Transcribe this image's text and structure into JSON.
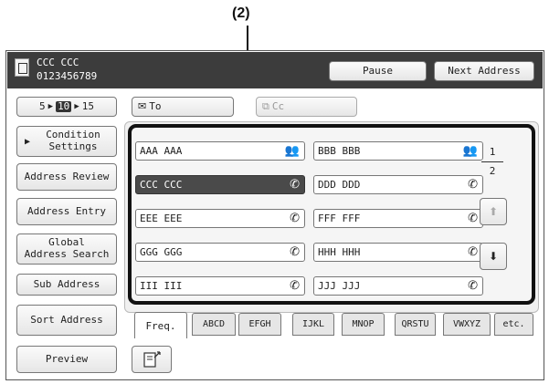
{
  "callout": "(2)",
  "header": {
    "name": "CCC CCC",
    "number": "0123456789",
    "pause_label": "Pause",
    "next_address_label": "Next Address"
  },
  "display_count": {
    "options": [
      "5",
      "10",
      "15"
    ],
    "selected": "10"
  },
  "to_label": "To",
  "cc_label": "Cc",
  "sidebar": {
    "condition_settings": "Condition\nSettings",
    "address_review": "Address Review",
    "address_entry": "Address Entry",
    "global_search": "Global\nAddress Search",
    "sub_address": "Sub Address",
    "sort_address": "Sort Address",
    "preview": "Preview"
  },
  "addresses": [
    {
      "name": "AAA AAA",
      "icon": "group-icon",
      "selected": false
    },
    {
      "name": "BBB BBB",
      "icon": "group-icon",
      "selected": false
    },
    {
      "name": "CCC CCC",
      "icon": "phone-icon",
      "selected": true
    },
    {
      "name": "DDD DDD",
      "icon": "phone-icon",
      "selected": false
    },
    {
      "name": "EEE EEE",
      "icon": "phone-icon",
      "selected": false
    },
    {
      "name": "FFF FFF",
      "icon": "phone-icon",
      "selected": false
    },
    {
      "name": "GGG GGG",
      "icon": "phone-icon",
      "selected": false
    },
    {
      "name": "HHH HHH",
      "icon": "phone-icon",
      "selected": false
    },
    {
      "name": "III III",
      "icon": "phone-icon",
      "selected": false
    },
    {
      "name": "JJJ JJJ",
      "icon": "phone-icon",
      "selected": false
    }
  ],
  "page": {
    "current": "1",
    "total": "2"
  },
  "tabs": [
    {
      "label": "Freq.",
      "active": true
    },
    {
      "label": "ABCD",
      "active": false
    },
    {
      "label": "EFGH",
      "active": false
    },
    {
      "label": "IJKL",
      "active": false
    },
    {
      "label": "MNOP",
      "active": false
    },
    {
      "label": "QRSTU",
      "active": false
    },
    {
      "label": "VWXYZ",
      "active": false
    },
    {
      "label": "etc.",
      "active": false
    }
  ]
}
